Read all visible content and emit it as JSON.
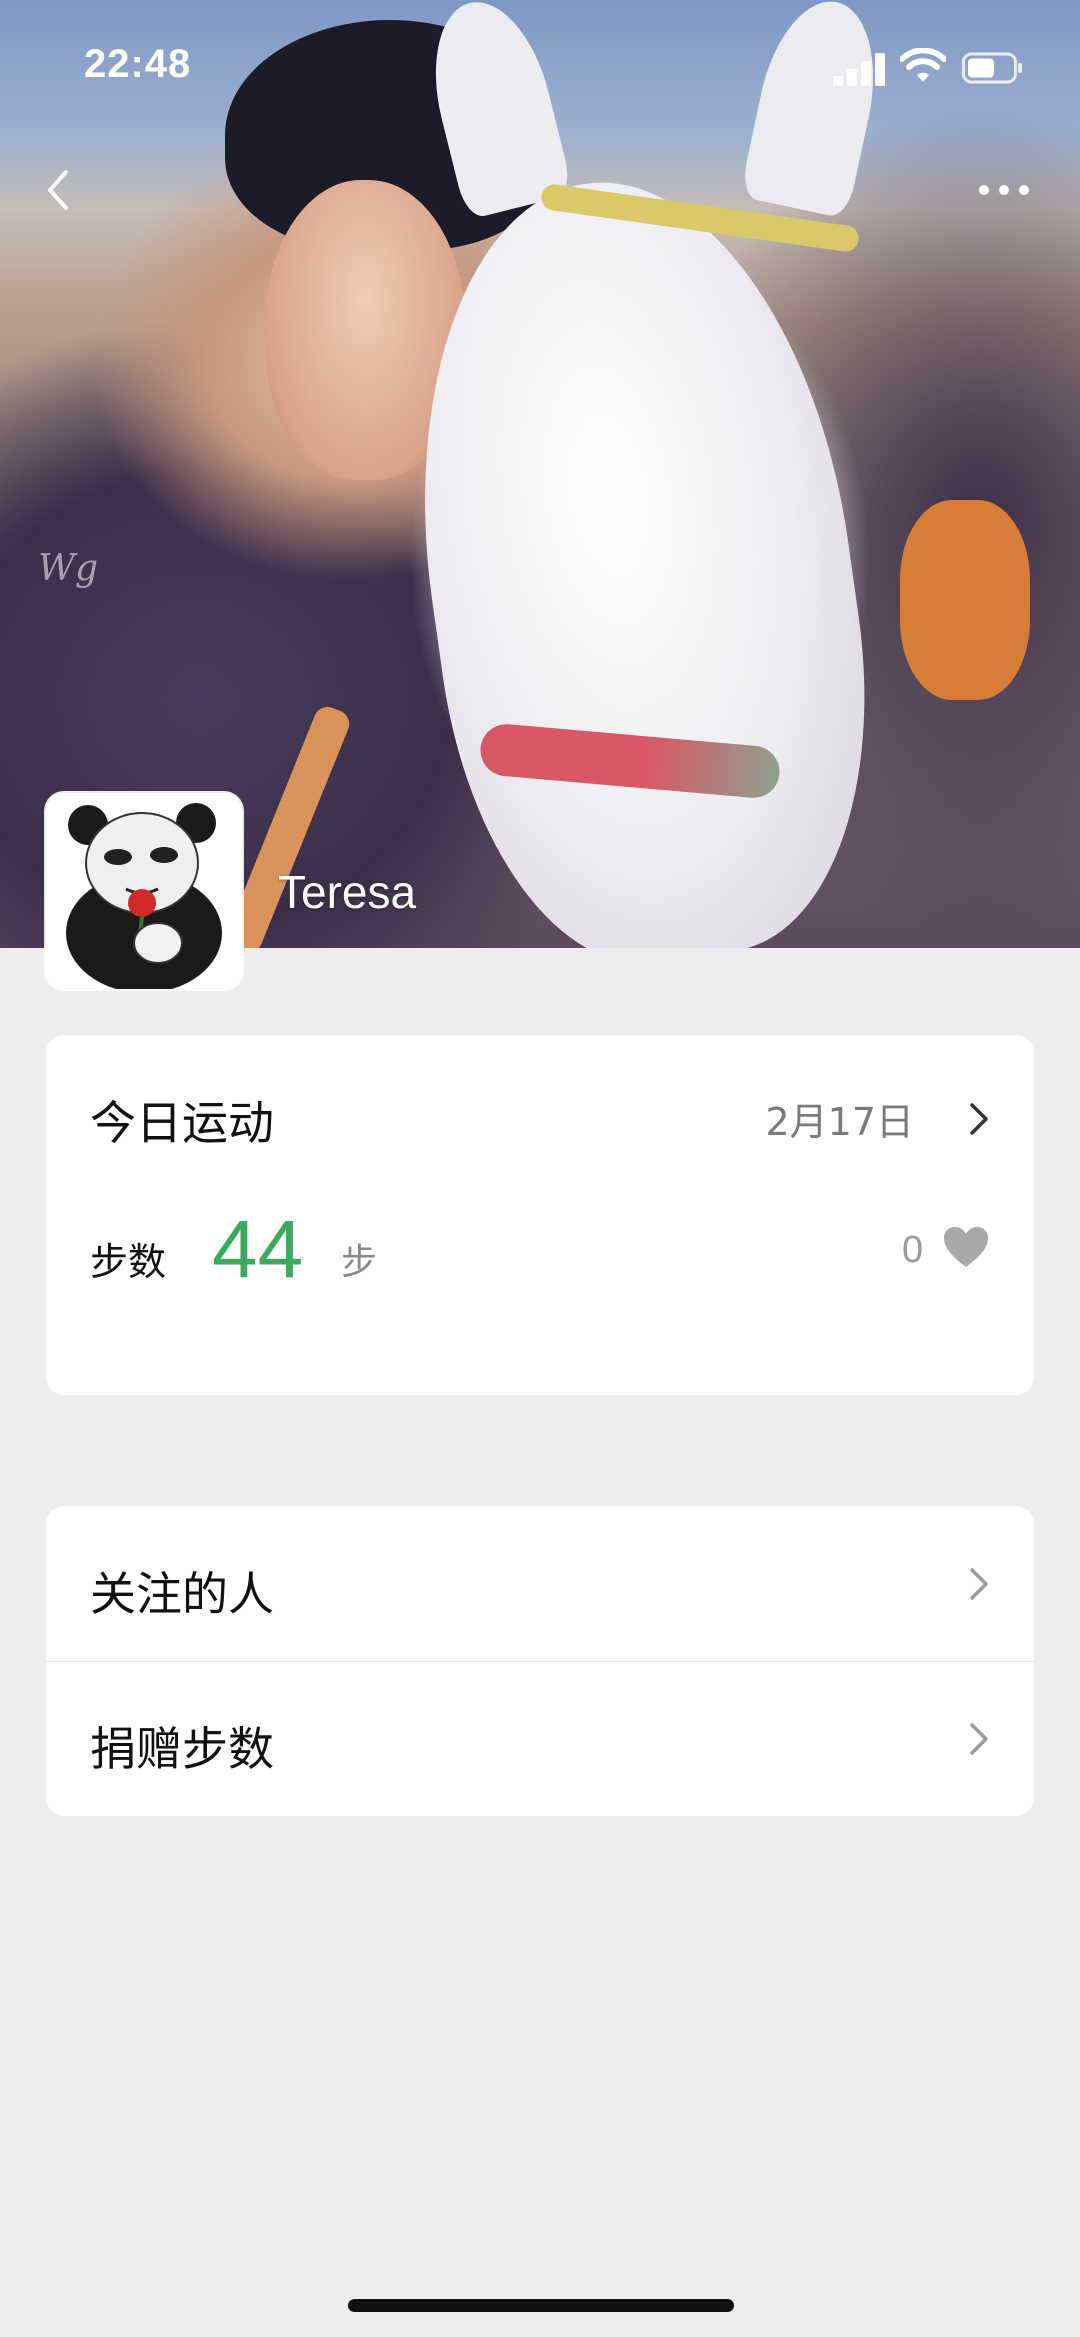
{
  "status_bar": {
    "time": "22:48"
  },
  "cover": {
    "watermark": "Wg"
  },
  "profile": {
    "name": "Teresa"
  },
  "today_card": {
    "title": "今日运动",
    "date": "2月17日",
    "steps_label": "步数",
    "steps_value": "44",
    "steps_unit": "步",
    "likes_count": "0"
  },
  "menu": {
    "items": [
      {
        "label": "关注的人"
      },
      {
        "label": "捐赠步数"
      }
    ]
  },
  "icons": [
    "back-icon",
    "more-icon",
    "chevron-right-icon",
    "heart-icon",
    "signal-icon",
    "wifi-icon",
    "battery-icon"
  ],
  "colors": {
    "steps_green": "#3ea85f",
    "background": "#ededed",
    "card": "#ffffff"
  }
}
